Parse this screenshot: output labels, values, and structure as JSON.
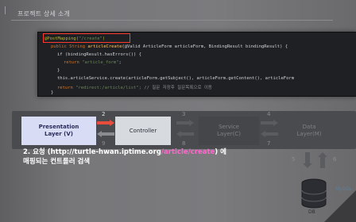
{
  "slide": {
    "title": "프로젝트 상세 소개"
  },
  "code": {
    "line1_prefix": "@PostMapping(",
    "line1_arg": "\"/create\"",
    "line1_suffix": ")",
    "line2_kw": "public String ",
    "line2_fn": "articleCreate",
    "line2_rest": "(@Valid ArticleForm articleForm, BindingResult bindingResult) {",
    "line3": "if (bindingResult.hasErrors()) {",
    "line4_kw": "return ",
    "line4_str": "\"article_form\"",
    "line4_end": ";",
    "line5": "}",
    "line6": "this.articleService.create(articleForm.getSubject(), articleForm.getContent(), articleForm",
    "line7_kw": "return ",
    "line7_str": "\"redirect:/article/list\"",
    "line7_cm": "; // 질문 저장후 질문목록으로 이동",
    "line8": "}"
  },
  "layers": {
    "presentation": "Presentation\nLayer (V)",
    "controller": "Controller",
    "service": "Service\nLayer(C)",
    "data": "Data\nLayer(M)",
    "db": "DB",
    "mysql": "MySQL"
  },
  "steps": {
    "n2": "2",
    "n3": "3",
    "n4": "4",
    "n5": "5",
    "n6": "6",
    "n7": "7",
    "n8": "8",
    "n9": "9"
  },
  "description": {
    "line1_prefix": "2. 요청 (http://turtle-hwan.iptime.org",
    "line1_pink": "/article/create",
    "line1_suffix": ") 에",
    "line2": "매핑되는 컨트롤러 검색"
  },
  "colors": {
    "highlight_box": "#ff3b30",
    "accent_pink": "#ff66cc",
    "active_arrow": "#e74c3c"
  }
}
